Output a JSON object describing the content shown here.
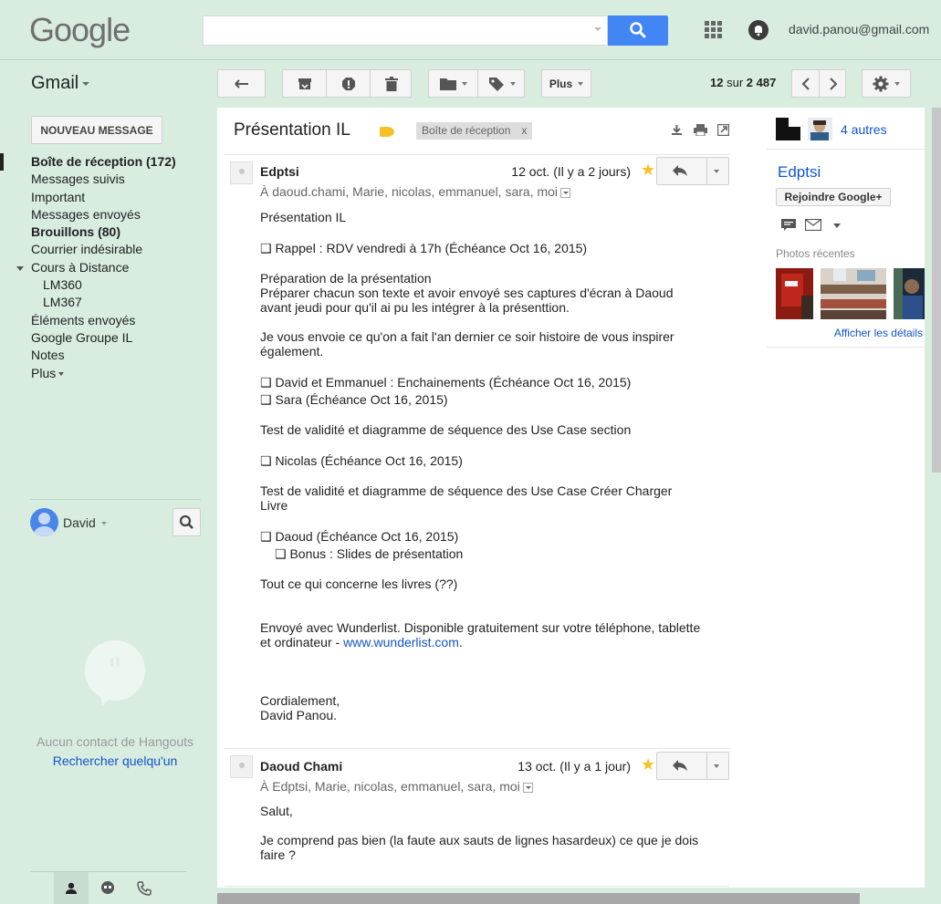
{
  "header": {
    "logo": "Google",
    "search": {
      "placeholder": "",
      "value": ""
    },
    "account_email": "david.panou@gmail.com"
  },
  "toolbar": {
    "app_name": "Gmail",
    "more_label": "Plus",
    "pager": {
      "current": "12",
      "of": "sur",
      "total": "2 487"
    }
  },
  "sidebar": {
    "compose_label": "NOUVEAU MESSAGE",
    "items": [
      {
        "label": "Boîte de réception (172)",
        "bold": true,
        "active": true
      },
      {
        "label": "Messages suivis"
      },
      {
        "label": "Important"
      },
      {
        "label": "Messages envoyés"
      },
      {
        "label": "Brouillons (80)",
        "bold": true
      },
      {
        "label": "Courrier indésirable"
      },
      {
        "label": "Cours à Distance",
        "expanded": true
      },
      {
        "label": "LM360",
        "sub": true
      },
      {
        "label": "LM367",
        "sub": true
      },
      {
        "label": "Éléments envoyés"
      },
      {
        "label": "Google Groupe IL"
      },
      {
        "label": "Notes"
      },
      {
        "label": "Plus"
      }
    ],
    "hangouts": {
      "user": "David",
      "empty_text": "Aucun contact de Hangouts",
      "find_link": "Rechercher quelqu'un"
    }
  },
  "thread": {
    "subject": "Présentation IL",
    "label_chip": "Boîte de réception",
    "label_chip_close": "x",
    "messages": [
      {
        "sender": "Edptsi",
        "date": "12 oct. (Il y a 2 jours)",
        "to": "À daoud.chami, Marie, nicolas, emmanuel, sara, moi",
        "body": [
          "Présentation IL",
          "❑ Rappel : RDV vendredi à 17h (Échéance Oct 16, 2015)",
          "Préparation de la présentation",
          "Préparer chacun son texte et avoir envoyé ses captures d'écran à Daoud",
          "avant jeudi pour qu'il ai pu les intégrer à la présenttion.",
          "Je vous envoie ce qu'on a fait l'an dernier ce soir histoire de vous inspirer",
          "également.",
          "❑ David et Emmanuel : Enchainements (Échéance Oct 16, 2015)",
          "❑ Sara (Échéance Oct 16, 2015)",
          "Test de validité et diagramme de séquence des Use Case section",
          "❑ Nicolas (Échéance Oct 16, 2015)",
          "Test de validité et diagramme de séquence des Use Case Créer Charger",
          "Livre",
          "❑ Daoud (Échéance Oct 16, 2015)",
          "❑ Bonus : Slides de présentation",
          "Tout ce qui concerne les livres (??)",
          "Envoyé avec Wunderlist. Disponible gratuitement sur votre téléphone, tablette",
          "et ordinateur - ",
          "www.wunderlist.com",
          ".",
          "Cordialement,",
          "David Panou."
        ]
      },
      {
        "sender": "Daoud Chami",
        "date": "13 oct. (Il y a 1 jour)",
        "to": "À Edptsi, Marie, nicolas, emmanuel, sara, moi",
        "body": [
          "Salut,",
          "Je comprend pas bien (la faute aux sauts de lignes hasardeux) ce que je dois",
          "faire ?"
        ]
      }
    ]
  },
  "side_panel": {
    "others": "4 autres",
    "contact_name": "Edptsi",
    "join_button": "Rejoindre Google+",
    "recent_photos_title": "Photos récentes",
    "details_link": "Afficher les détails"
  },
  "colors": {
    "background": "#d8ede0",
    "accent_blue": "#4285f4",
    "link": "#1155cc",
    "star": "#f6c026"
  }
}
